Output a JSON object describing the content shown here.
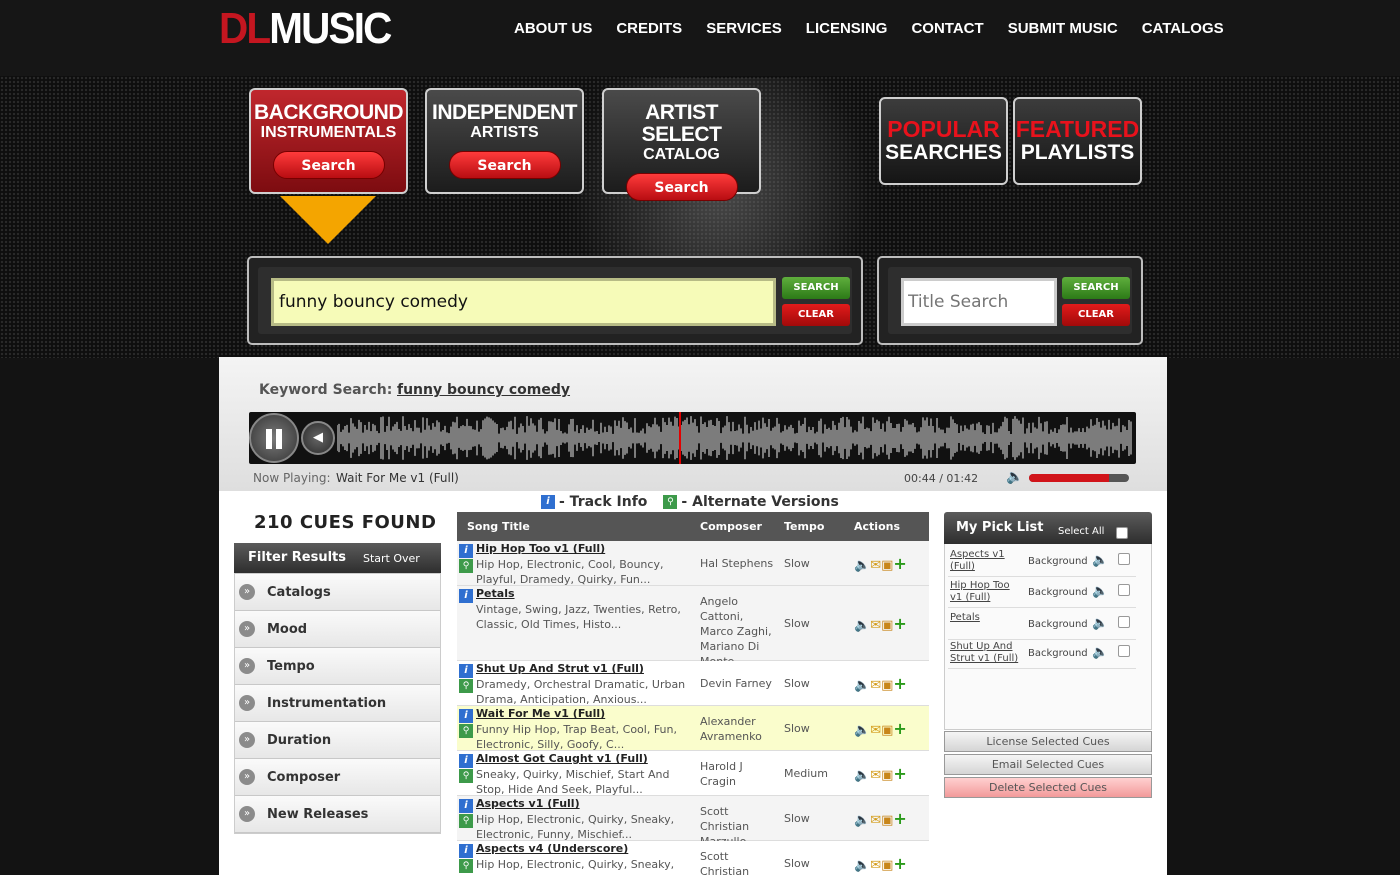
{
  "header": {
    "logo_dl": "DL",
    "logo_music": "MUSIC",
    "nav": [
      "ABOUT US",
      "CREDITS",
      "SERVICES",
      "LICENSING",
      "CONTACT",
      "SUBMIT MUSIC",
      "CATALOGS"
    ]
  },
  "categories": [
    {
      "line1": "BACKGROUND",
      "line2": "INSTRUMENTALS",
      "button": "Search",
      "active": true
    },
    {
      "line1": "INDEPENDENT",
      "line2": "ARTISTS",
      "button": "Search",
      "active": false
    },
    {
      "line1": "ARTIST SELECT",
      "line2": "CATALOG",
      "button": "Search",
      "active": false
    }
  ],
  "promos": [
    {
      "red": "POPULAR",
      "white": "SEARCHES"
    },
    {
      "red": "FEATURED",
      "white": "PLAYLISTS"
    }
  ],
  "keyword_search": {
    "value": "funny bouncy comedy",
    "search_label": "SEARCH",
    "clear_label": "CLEAR"
  },
  "title_search": {
    "placeholder": "Title Search",
    "search_label": "SEARCH",
    "clear_label": "CLEAR"
  },
  "results_header": {
    "label": "Keyword Search:",
    "value": "funny bouncy comedy"
  },
  "player": {
    "now_playing_label": "Now Playing:",
    "track": "Wait For Me v1 (Full)",
    "time": "00:44 / 01:42",
    "volume": 0.8,
    "progress": 0.43
  },
  "legend": {
    "track_info": "- Track Info",
    "alt_versions": "- Alternate Versions"
  },
  "cues_found": "210 CUES FOUND",
  "filter": {
    "title": "Filter Results",
    "start_over": "Start Over",
    "items": [
      "Catalogs",
      "Mood",
      "Tempo",
      "Instrumentation",
      "Duration",
      "Composer",
      "New Releases"
    ]
  },
  "table": {
    "columns": [
      "Song Title",
      "Composer",
      "Tempo",
      "Actions"
    ],
    "rows": [
      {
        "title": "Hip Hop Too v1 (Full)",
        "desc": "Hip Hop, Electronic, Cool, Bouncy, Playful, Dramedy, Quirky, Fun...",
        "composer": "Hal Stephens",
        "tempo": "Slow",
        "alt": true,
        "style": "alt"
      },
      {
        "title": "Petals",
        "desc": "Vintage, Swing, Jazz, Twenties, Retro, Classic, Old Times, Histo...",
        "composer": "Angelo Cattoni, Marco Zaghi, Mariano Di Monte",
        "tempo": "Slow",
        "alt": false,
        "style": "alt"
      },
      {
        "title": "Shut Up And Strut v1 (Full)",
        "desc": "Dramedy, Orchestral Dramatic, Urban Drama, Anticipation, Anxious...",
        "composer": "Devin Farney",
        "tempo": "Slow",
        "alt": true,
        "style": ""
      },
      {
        "title": "Wait For Me v1 (Full)",
        "desc": "Funny Hip Hop, Trap Beat, Cool, Fun, Electronic, Silly, Goofy, C...",
        "composer": "Alexander Avramenko",
        "tempo": "Slow",
        "alt": true,
        "style": "hl"
      },
      {
        "title": "Almost Got Caught v1 (Full)",
        "desc": "Sneaky, Quirky, Mischief, Start And Stop, Hide And Seek, Playful...",
        "composer": "Harold J Cragin",
        "tempo": "Medium",
        "alt": true,
        "style": ""
      },
      {
        "title": "Aspects v1 (Full)",
        "desc": "Hip Hop, Electronic, Quirky, Sneaky, Electronic, Funny, Mischief...",
        "composer": "Scott Christian Marzullo",
        "tempo": "Slow",
        "alt": true,
        "style": "alt"
      },
      {
        "title": "Aspects v4 (Underscore)",
        "desc": "Hip Hop, Electronic, Quirky, Sneaky, Electronic, Funny, Mischief...",
        "composer": "Scott Christian Marzullo",
        "tempo": "Slow",
        "alt": true,
        "style": ""
      }
    ]
  },
  "picklist": {
    "title": "My Pick List",
    "select_all": "Select All",
    "items": [
      {
        "title": "Aspects v1 (Full)",
        "catalog": "Background"
      },
      {
        "title": "Hip Hop Too v1 (Full)",
        "catalog": "Background"
      },
      {
        "title": "Petals",
        "catalog": "Background"
      },
      {
        "title": "Shut Up And Strut v1 (Full)",
        "catalog": "Background"
      }
    ],
    "buttons": [
      "License Selected Cues",
      "Email Selected Cues",
      "Delete Selected Cues"
    ]
  }
}
